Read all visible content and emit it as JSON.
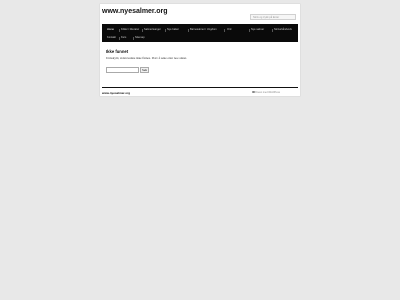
{
  "header": {
    "site_title": "www.nyesalmer.org",
    "search_placeholder": "Skriv og trykk på Enter"
  },
  "nav": {
    "items": [
      {
        "label": "Home"
      },
      {
        "label": "Kilder / litteratur"
      },
      {
        "label": "Salmer/sanger"
      },
      {
        "label": "Nye bøker"
      },
      {
        "label": "Barnesalmer / Ungdom"
      },
      {
        "label": "Ord"
      },
      {
        "label": "Nye salmer"
      },
      {
        "label": "Skrivehåndverk"
      },
      {
        "label": "Kontakt"
      },
      {
        "label": "Kurs"
      },
      {
        "label": "Sitemap"
      }
    ]
  },
  "content": {
    "title": "Ikke funnet",
    "text": "Unnskyld, siden kunne ikke finnes. Prøv å søke etter noe annet.",
    "search_button": "Søk"
  },
  "footer": {
    "site": "www.nyesalmer.org",
    "credit": "Drevet med WordPress"
  }
}
